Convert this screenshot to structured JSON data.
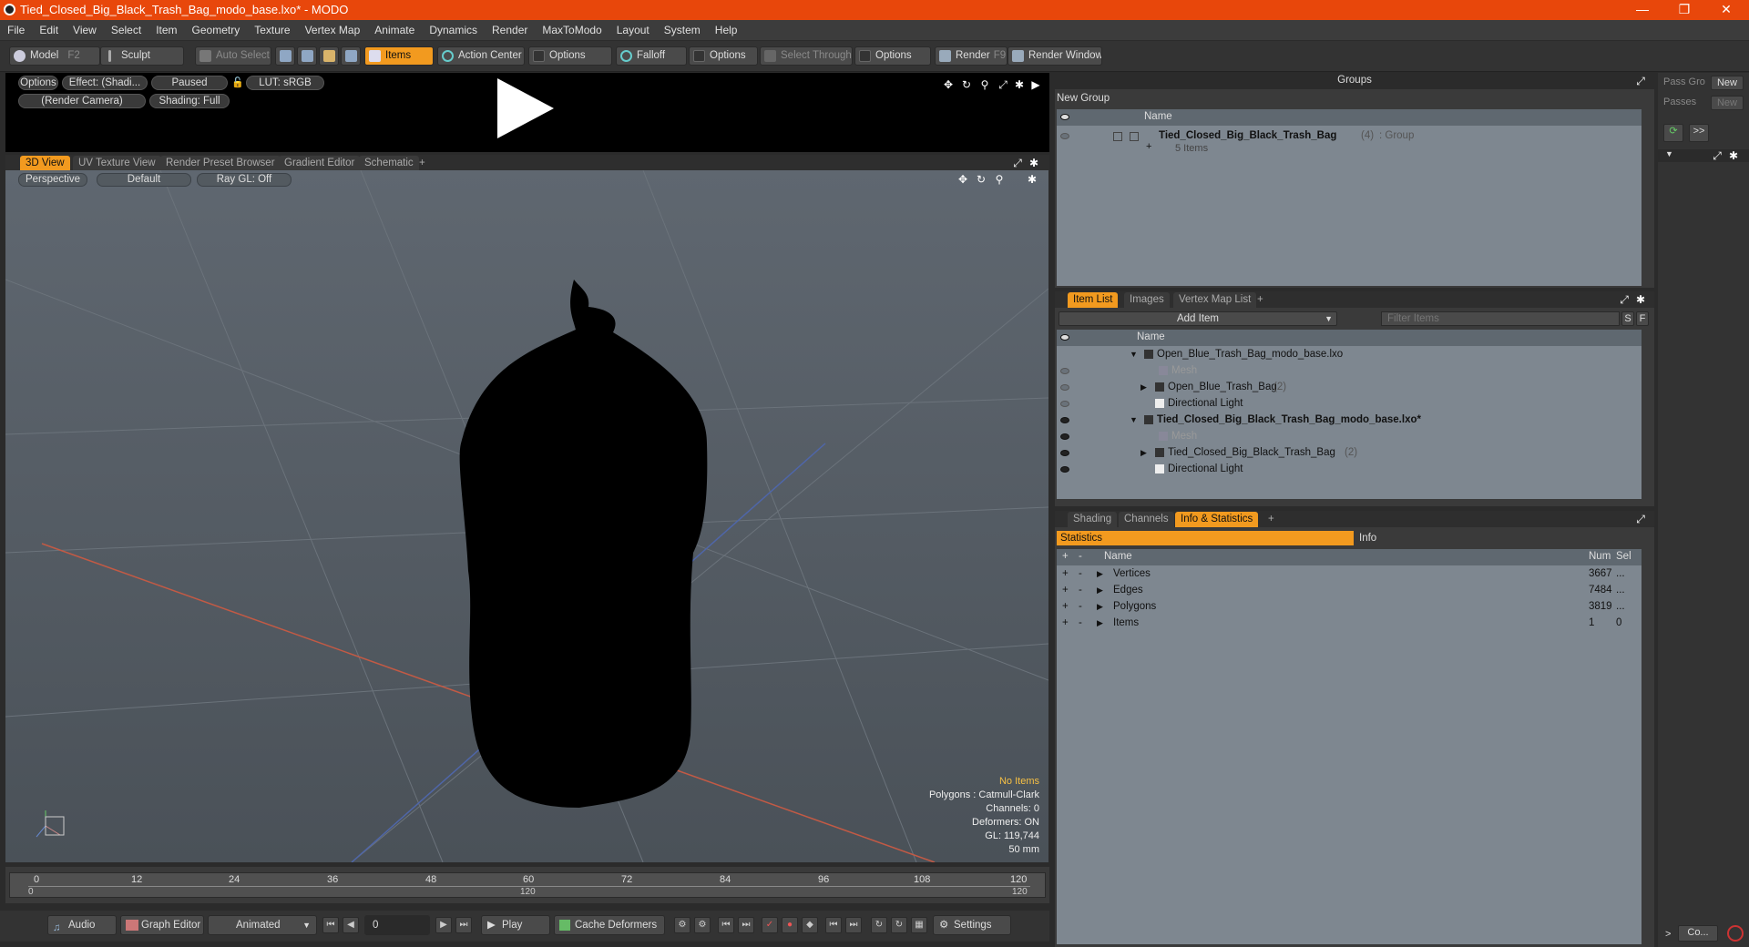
{
  "window": {
    "title": "Tied_Closed_Big_Black_Trash_Bag_modo_base.lxo* - MODO",
    "minimize": "—",
    "maximize": "❐",
    "close": "✕"
  },
  "menu": [
    "File",
    "Edit",
    "View",
    "Select",
    "Item",
    "Geometry",
    "Texture",
    "Vertex Map",
    "Animate",
    "Dynamics",
    "Render",
    "MaxToModo",
    "Layout",
    "System",
    "Help"
  ],
  "toolbar": {
    "model": "Model",
    "model_key": "F2",
    "sculpt": "Sculpt",
    "auto_select": "Auto Select",
    "items": "Items",
    "action_center": "Action Center",
    "options1": "Options",
    "falloff": "Falloff",
    "options2": "Options",
    "select_through": "Select Through",
    "options3": "Options",
    "render": "Render",
    "render_key": "F9",
    "render_window": "Render Window"
  },
  "preview": {
    "options": "Options",
    "effect": "Effect: (Shadi...",
    "paused": "Paused",
    "lut": "LUT: sRGB",
    "camera": "(Render Camera)",
    "shading": "Shading: Full"
  },
  "viewport_tabs": [
    "3D View",
    "UV Texture View",
    "Render Preset Browser",
    "Gradient Editor",
    "Schematic",
    "+"
  ],
  "viewport": {
    "projection": "Perspective",
    "style": "Default",
    "raygl": "Ray GL: Off",
    "overlay": {
      "items": "No Items",
      "polygons": "Polygons : Catmull-Clark",
      "channels": "Channels: 0",
      "deformers": "Deformers: ON",
      "gl": "GL: 119,744",
      "lens": "50 mm"
    }
  },
  "timeline": {
    "ticks": [
      "0",
      "12",
      "24",
      "36",
      "48",
      "60",
      "72",
      "84",
      "96",
      "108",
      "120"
    ],
    "range_start": "0",
    "range_mid": "120",
    "range_end": "120"
  },
  "bottom": {
    "audio": "Audio",
    "graph_editor": "Graph Editor",
    "animated": "Animated",
    "frame": "0",
    "play": "Play",
    "cache_deformers": "Cache Deformers",
    "settings": "Settings"
  },
  "groups": {
    "title": "Groups",
    "new_group": "New Group",
    "col_name": "Name",
    "group_name": "Tied_Closed_Big_Black_Trash_Bag",
    "group_count": "(4)",
    "group_type": ": Group",
    "group_items": "5 Items"
  },
  "item_list": {
    "tabs": [
      "Item List",
      "Images",
      "Vertex Map List",
      "+"
    ],
    "add_item": "Add Item",
    "filter_placeholder": "Filter Items",
    "s": "S",
    "f": "F",
    "col_name": "Name",
    "rows": [
      {
        "label": "Open_Blue_Trash_Bag_modo_base.lxo",
        "count": "",
        "bold": false
      },
      {
        "label": "Mesh",
        "count": "",
        "bold": false
      },
      {
        "label": "Open_Blue_Trash_Bag",
        "count": "(2)",
        "bold": false
      },
      {
        "label": "Directional Light",
        "count": "",
        "bold": false
      },
      {
        "label": "Tied_Closed_Big_Black_Trash_Bag_modo_base.lxo*",
        "count": "",
        "bold": true
      },
      {
        "label": "Mesh",
        "count": "",
        "bold": false
      },
      {
        "label": "Tied_Closed_Big_Black_Trash_Bag",
        "count": "(2)",
        "bold": false
      },
      {
        "label": "Directional Light",
        "count": "",
        "bold": false
      }
    ]
  },
  "stats": {
    "tabs": [
      "Shading",
      "Channels",
      "Info & Statistics",
      "+"
    ],
    "statistics": "Statistics",
    "info": "Info",
    "col_name": "Name",
    "col_num": "Num",
    "col_sel": "Sel",
    "rows": [
      {
        "name": "Vertices",
        "num": "3667",
        "sel": "..."
      },
      {
        "name": "Edges",
        "num": "7484",
        "sel": "..."
      },
      {
        "name": "Polygons",
        "num": "3819",
        "sel": "..."
      },
      {
        "name": "Items",
        "num": "1",
        "sel": "0"
      }
    ]
  },
  "side": {
    "pass_group": "Pass Gro",
    "passes": "Passes",
    "new1": "New",
    "new2": "New",
    "more": ">>",
    "co": "Co..."
  },
  "colors": {
    "accent": "#f29a1f",
    "title": "#e8470b"
  }
}
